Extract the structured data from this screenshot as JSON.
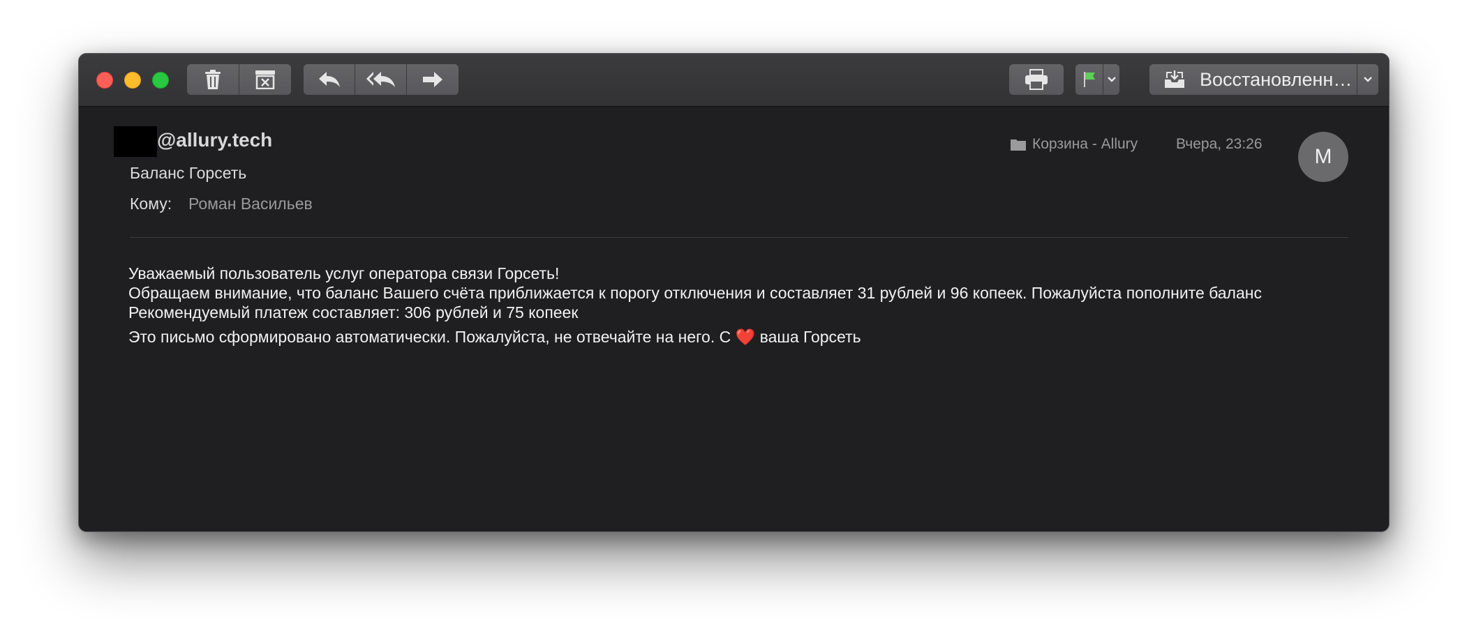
{
  "toolbar": {
    "trash_icon": "trash-icon",
    "archive_icon": "archive-icon",
    "reply_icon": "reply-icon",
    "reply_all_icon": "reply-all-icon",
    "forward_icon": "forward-icon",
    "print_icon": "printer-icon",
    "flag_icon": "flag-icon",
    "flag_color": "#5fd05a",
    "move_label": "Восстановленн…"
  },
  "message": {
    "sender_domain": "@allury.tech",
    "subject": "Баланс Горсеть",
    "to_label": "Кому:",
    "to_value": "Роман Васильев",
    "mailbox": "Корзина - Allury",
    "date": "Вчера, 23:26",
    "avatar_initial": "M"
  },
  "body": {
    "line1": "Уважаемый пользователь услуг оператора связи Горсеть!",
    "line2": "Обращаем внимание, что баланс Вашего счёта приближается к порогу отключения и составляет 31 рублей и 96 копеек. Пожалуйста пополните баланс",
    "line3": "Рекомендуемый платеж составляет: 306 рублей и 75 копеек",
    "line4_before": "Это письмо сформировано автоматически. Пожалуйста, не отвечайте на него. С",
    "heart": "❤️",
    "line4_after": "ваша Горсеть"
  }
}
